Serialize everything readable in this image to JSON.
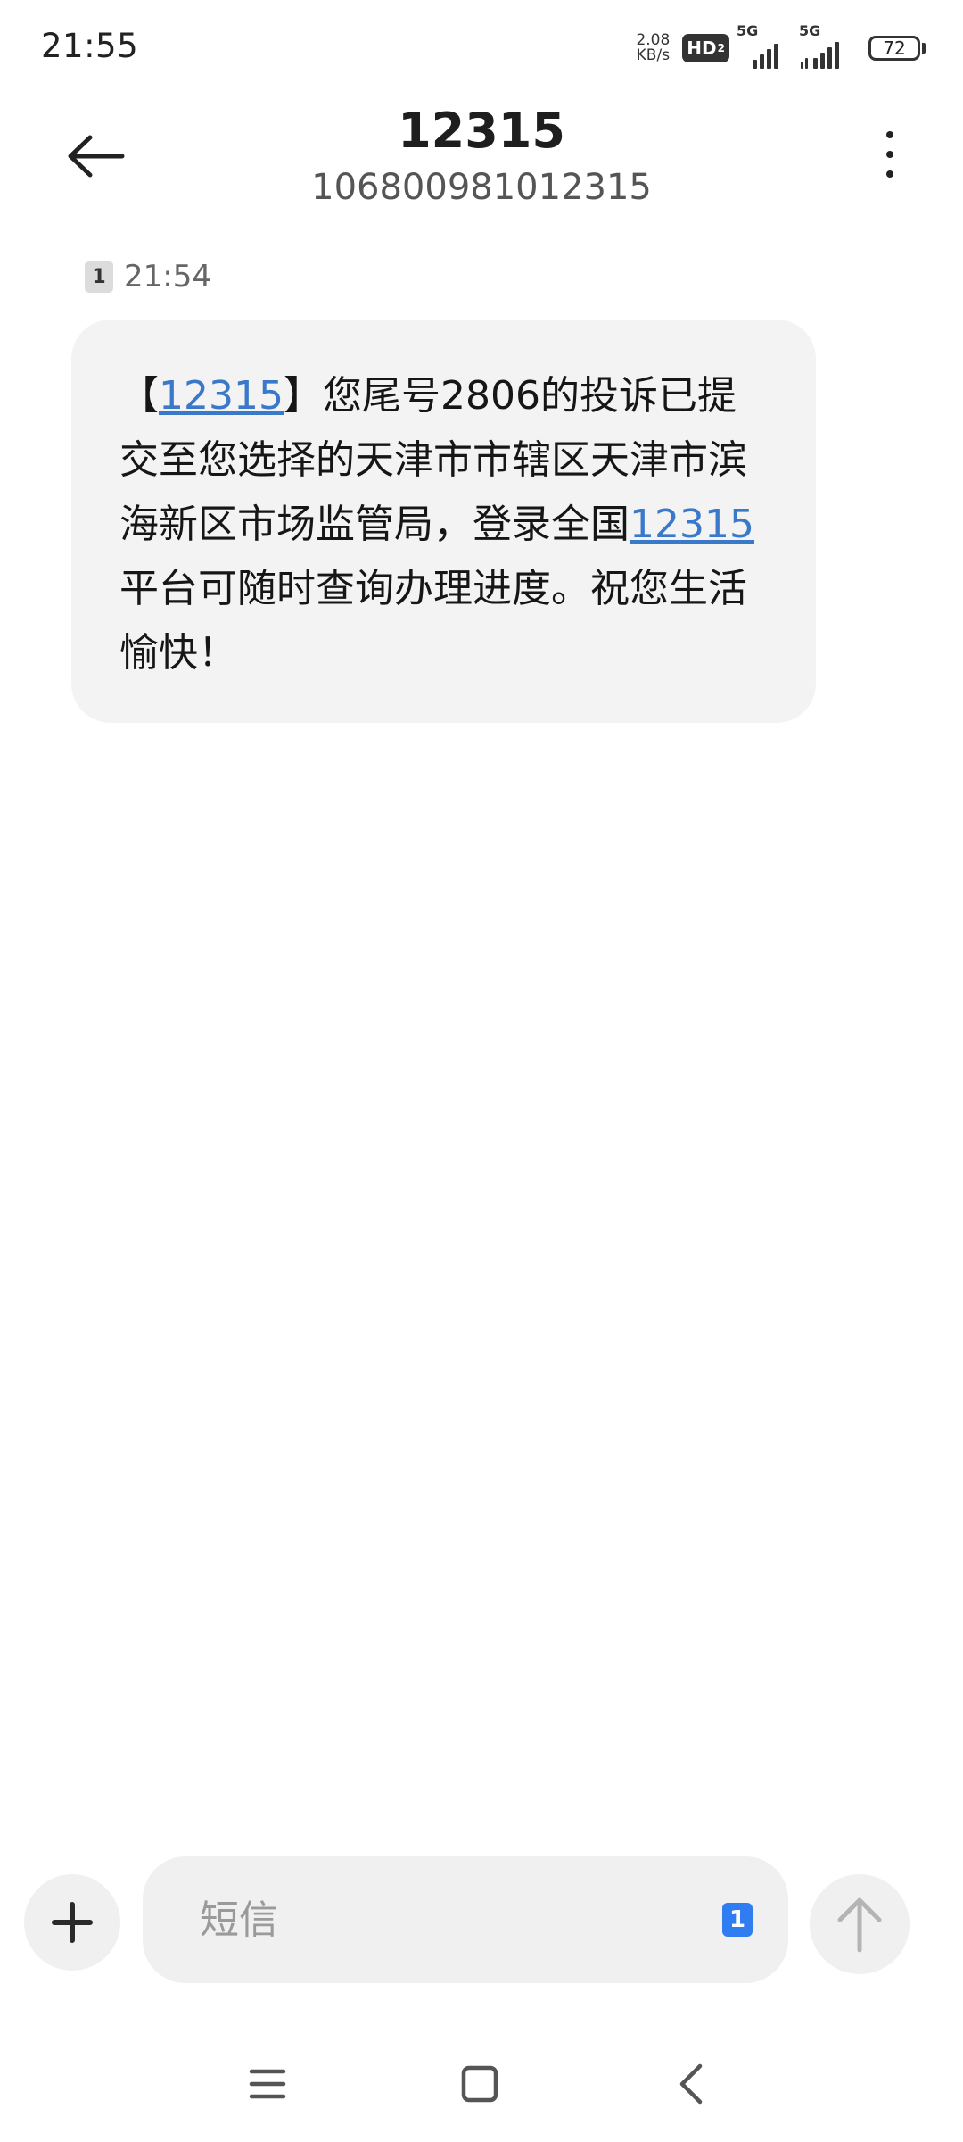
{
  "status_bar": {
    "time": "21:55",
    "net_speed_value": "2.08",
    "net_speed_unit": "KB/s",
    "hd_label": "HD",
    "hd_sub": "2",
    "sim1_label": "5G",
    "sim2_label": "5G",
    "battery_level": "72"
  },
  "header": {
    "contact_name": "12315",
    "contact_number": "106800981012315",
    "back_icon": "arrow-left-icon",
    "more_icon": "more-vertical-icon"
  },
  "message": {
    "sim_slot": "1",
    "time": "21:54",
    "parts": {
      "p1": "【",
      "link1": "12315",
      "p2": "】您尾号2806的投诉已提交至您选择的天津市市辖区天津市滨海新区市场监管局，登录全国",
      "link2": "12315",
      "p3": "平台可随时查询办理进度。祝您生活愉快！"
    },
    "link_color": "#3a78c9"
  },
  "compose": {
    "placeholder": "短信",
    "value": "",
    "sim_slot": "1",
    "add_icon": "plus-icon",
    "send_icon": "arrow-up-icon",
    "sim_color": "#2f7df0"
  },
  "nav_bar": {
    "menu_icon": "menu-icon",
    "home_icon": "home-square-icon",
    "back_icon": "chevron-left-icon"
  }
}
